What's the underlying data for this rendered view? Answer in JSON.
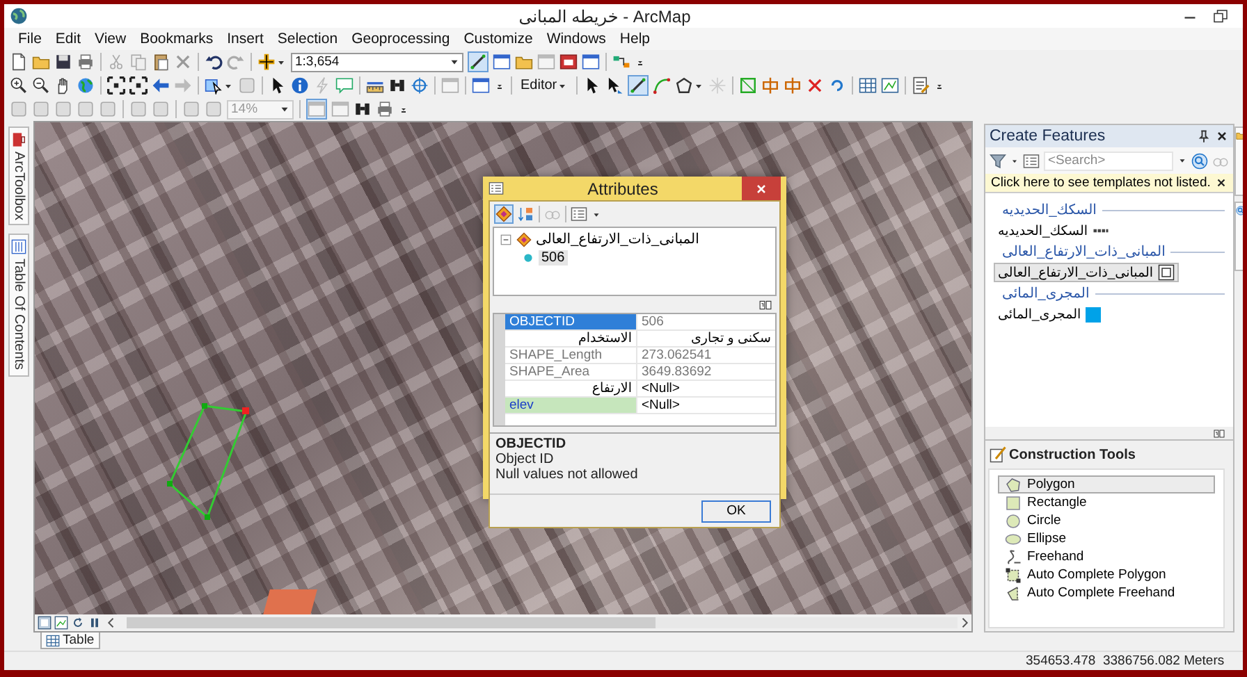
{
  "window": {
    "title": "خريطه المبانى - ArcMap"
  },
  "menu": [
    "File",
    "Edit",
    "View",
    "Bookmarks",
    "Insert",
    "Selection",
    "Geoprocessing",
    "Customize",
    "Windows",
    "Help"
  ],
  "toolbars": {
    "scale": "1:3,654",
    "editor": "Editor",
    "zoom_percent": "14%"
  },
  "left_tabs": [
    "ArcToolbox",
    "Table Of Contents"
  ],
  "attributes_dialog": {
    "title": "Attributes",
    "layer": "المبانى_ذات_الارتفاع_العالى",
    "feature": "506",
    "fields": [
      {
        "name": "OBJECTID",
        "value": "506",
        "selected": true,
        "kind": "readonly"
      },
      {
        "name": "الاستخدام",
        "value": "سكنى و تجارى",
        "selected": false,
        "kind": "editable"
      },
      {
        "name": "SHAPE_Length",
        "value": "273.062541",
        "selected": false,
        "kind": "readonly"
      },
      {
        "name": "SHAPE_Area",
        "value": "3649.83692",
        "selected": false,
        "kind": "readonly"
      },
      {
        "name": "الارتفاع",
        "value": "<Null>",
        "selected": false,
        "kind": "editable"
      },
      {
        "name": "elev",
        "value": "<Null>",
        "selected": false,
        "kind": "marked"
      }
    ],
    "description": {
      "title": "OBJECTID",
      "lines": [
        "Object ID",
        "Null values not allowed"
      ]
    },
    "ok_button": "OK"
  },
  "create_features": {
    "title": "Create Features",
    "search_placeholder": "<Search>",
    "notice": "Click here to see templates not listed.",
    "groups": [
      {
        "name": "السكك_الحديديه",
        "templates": [
          {
            "name": "السكك_الحديديه",
            "kind": "line",
            "selected": false
          }
        ]
      },
      {
        "name": "المبانى_ذات_الارتفاع_العالى",
        "templates": [
          {
            "name": "المبانى_ذات_الارتفاع_العالى",
            "kind": "outline",
            "selected": true
          }
        ]
      },
      {
        "name": "المجرى_المائى",
        "templates": [
          {
            "name": "المجرى_المائى",
            "kind": "fill",
            "color": "#00a2e8",
            "selected": false
          }
        ]
      }
    ]
  },
  "construction_tools": {
    "title": "Construction Tools",
    "tools": [
      {
        "label": "Polygon",
        "kind": "polygon",
        "selected": true
      },
      {
        "label": "Rectangle",
        "kind": "rectangle",
        "selected": false
      },
      {
        "label": "Circle",
        "kind": "circle",
        "selected": false
      },
      {
        "label": "Ellipse",
        "kind": "ellipse",
        "selected": false
      },
      {
        "label": "Freehand",
        "kind": "freehand",
        "selected": false
      },
      {
        "label": "Auto Complete Polygon",
        "kind": "autopolygon",
        "selected": false
      },
      {
        "label": "Auto Complete Freehand",
        "kind": "autofreehand",
        "selected": false
      }
    ]
  },
  "table_tab": "Table",
  "status_bar": "354653.478  3386756.082 Meters"
}
